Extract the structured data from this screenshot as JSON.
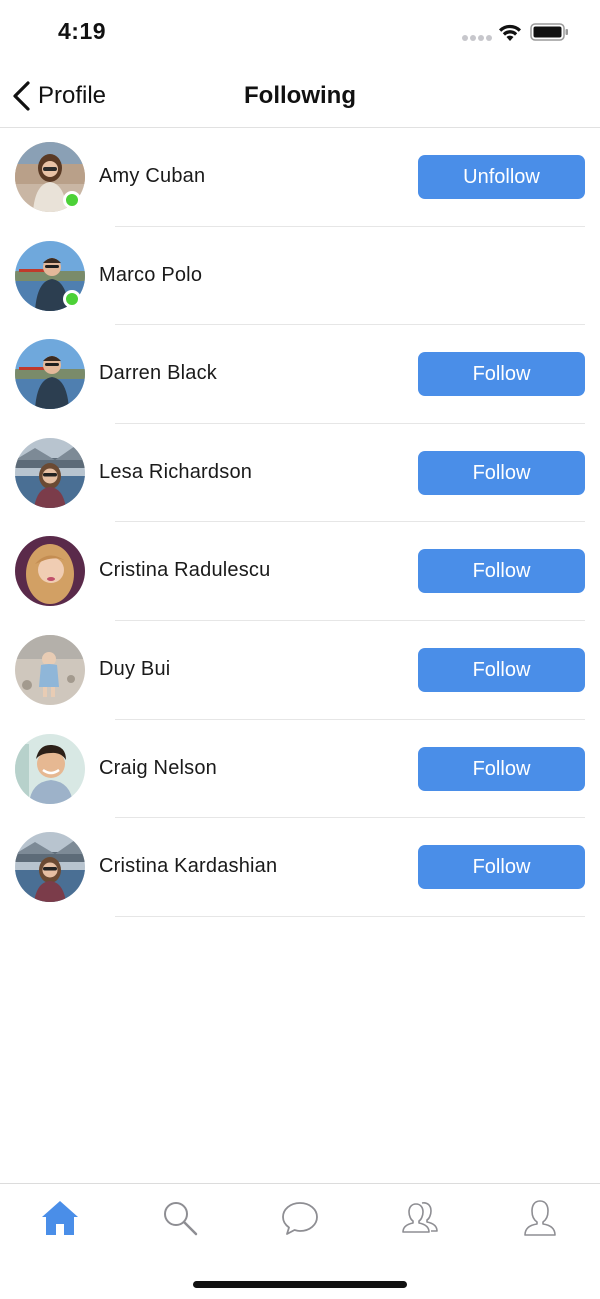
{
  "status_bar": {
    "time": "4:19",
    "signal_icon": "signal-dots-icon",
    "wifi_icon": "wifi-icon",
    "battery_icon": "battery-icon"
  },
  "nav": {
    "back_icon": "chevron-left-icon",
    "back_label": "Profile",
    "title": "Following"
  },
  "colors": {
    "accent": "#4a8ee8",
    "online": "#4cd137",
    "divider": "#e6e6e6",
    "inactive_tab": "#8e8e93"
  },
  "users": [
    {
      "name": "Amy Cuban",
      "online": true,
      "button": "Unfollow"
    },
    {
      "name": "Marco Polo",
      "online": true,
      "button": ""
    },
    {
      "name": "Darren Black",
      "online": false,
      "button": "Follow"
    },
    {
      "name": "Lesa Richardson",
      "online": false,
      "button": "Follow"
    },
    {
      "name": "Cristina Radulescu",
      "online": false,
      "button": "Follow"
    },
    {
      "name": "Duy Bui",
      "online": false,
      "button": "Follow"
    },
    {
      "name": "Craig Nelson",
      "online": false,
      "button": "Follow"
    },
    {
      "name": "Cristina Kardashian",
      "online": false,
      "button": "Follow"
    }
  ],
  "tabs": [
    {
      "icon": "home-icon",
      "active": true
    },
    {
      "icon": "search-icon",
      "active": false
    },
    {
      "icon": "chat-bubble-icon",
      "active": false
    },
    {
      "icon": "friends-icon",
      "active": false
    },
    {
      "icon": "profile-icon",
      "active": false
    }
  ]
}
